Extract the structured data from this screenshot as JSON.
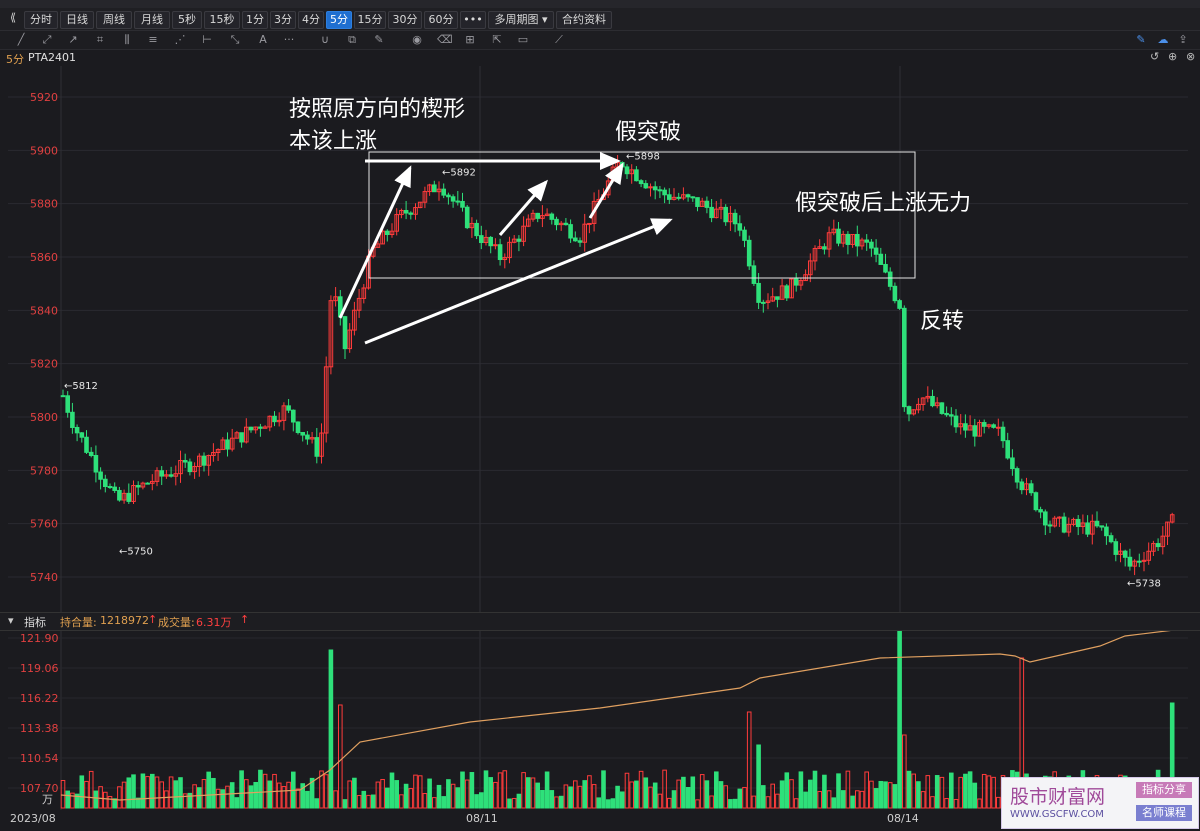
{
  "toolbar": {
    "periods": [
      "分时",
      "日线",
      "周线",
      "月线",
      "5秒",
      "15秒",
      "1分",
      "3分",
      "4分",
      "5分",
      "15分",
      "30分",
      "60分",
      "•••",
      "多周期图 ▾",
      "合约资料"
    ],
    "active_period": "5分"
  },
  "chart_title": {
    "period": "5分",
    "symbol": "PTA2401"
  },
  "annotations": {
    "wedge": [
      "按照原方向的楔形",
      "本该上涨"
    ],
    "false_break": "假突破",
    "weak_after": "假突破后上涨无力",
    "reversal": "反转"
  },
  "price_labels": {
    "high1": "←5812",
    "low1": "←5750",
    "high2": "←5892",
    "high3": "←5898",
    "low2": "←5738"
  },
  "indicator_bar": {
    "label": "指标",
    "oi_label": "持合量:",
    "oi_value": "1218972",
    "vol_label": "成交量:",
    "vol_value": "6.31万"
  },
  "watermark": {
    "brand": "股市财富网",
    "url": "WWW.GSCFW.COM",
    "tag1": "指标分享",
    "tag2": "名师课程"
  },
  "chart_data": [
    {
      "type": "candlestick",
      "symbol": "PTA2401",
      "period": "5分",
      "y_ticks": [
        5920,
        5900,
        5880,
        5860,
        5840,
        5820,
        5800,
        5780,
        5760,
        5740
      ],
      "ylim": [
        5733,
        5928
      ],
      "x_labels": [
        "2023/08",
        "08/11",
        "08/14"
      ],
      "marked_values": [
        5812,
        5750,
        5892,
        5898,
        5738
      ],
      "colors": {
        "up": "#ff3b3b",
        "down": "#2ee07a"
      }
    },
    {
      "type": "bar",
      "name": "成交量",
      "unit": "万",
      "y_ticks": [
        121.9,
        119.06,
        116.22,
        113.38,
        110.54,
        107.7
      ],
      "y_tick_labels": [
        "121.90",
        "119.06",
        "116.22",
        "113.38",
        "110.54",
        "107.70"
      ],
      "line_series_color": "#e0a060"
    }
  ]
}
